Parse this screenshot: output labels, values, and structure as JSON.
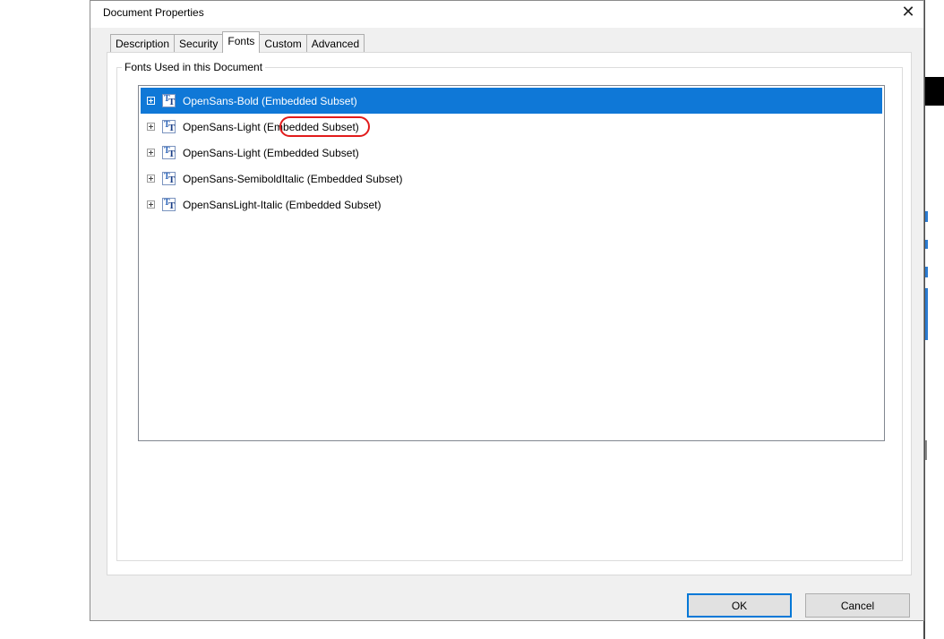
{
  "dialog": {
    "title": "Document Properties",
    "close_glyph": "✕"
  },
  "tabs": [
    {
      "label": "Description",
      "active": false
    },
    {
      "label": "Security",
      "active": false
    },
    {
      "label": "Fonts",
      "active": true
    },
    {
      "label": "Custom",
      "active": false
    },
    {
      "label": "Advanced",
      "active": false
    }
  ],
  "fonts_group": {
    "legend": "Fonts Used in this Document",
    "items": [
      {
        "label": "OpenSans-Bold (Embedded Subset)",
        "selected": true,
        "icon": "truetype-font-icon"
      },
      {
        "label": "OpenSans-Light (Embedded Subset)",
        "selected": false,
        "icon": "truetype-font-icon",
        "annotated": true
      },
      {
        "label": "OpenSans-Light (Embedded Subset)",
        "selected": false,
        "icon": "truetype-font-icon"
      },
      {
        "label": "OpenSans-SemiboldItalic (Embedded Subset)",
        "selected": false,
        "icon": "truetype-font-icon"
      },
      {
        "label": "OpenSansLight-Italic (Embedded Subset)",
        "selected": false,
        "icon": "truetype-font-icon"
      }
    ]
  },
  "buttons": {
    "ok": "OK",
    "cancel": "Cancel"
  },
  "colors": {
    "selection": "#0f78d7",
    "annotation": "#e21b1b"
  }
}
